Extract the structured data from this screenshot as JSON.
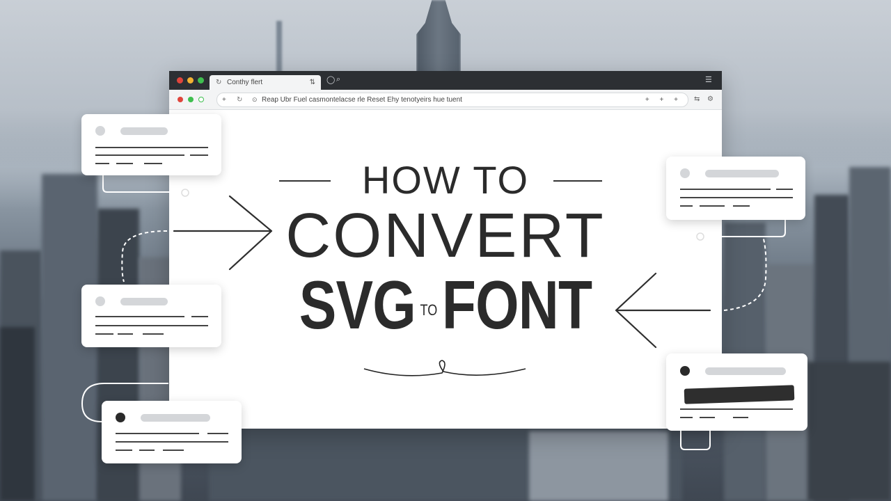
{
  "browser": {
    "tab": {
      "icon": "reload-icon",
      "title": "Conthy flert",
      "close": "⇅"
    },
    "address": {
      "plus": "+",
      "reload": "↻",
      "url": "Reap Ubr Fuel casmontelacse rle Reset Ehy tenotyeirs hue tuent",
      "actions": "+ + +"
    },
    "colors": {
      "close": "#e0453c",
      "minimize": "#f3b233",
      "maximize": "#3fbf4f"
    }
  },
  "headline": {
    "line1": "HOW TO",
    "line2": "CONVERT",
    "line3_left": "SVG",
    "line3_mid": "TO",
    "line3_right": "FONT"
  }
}
